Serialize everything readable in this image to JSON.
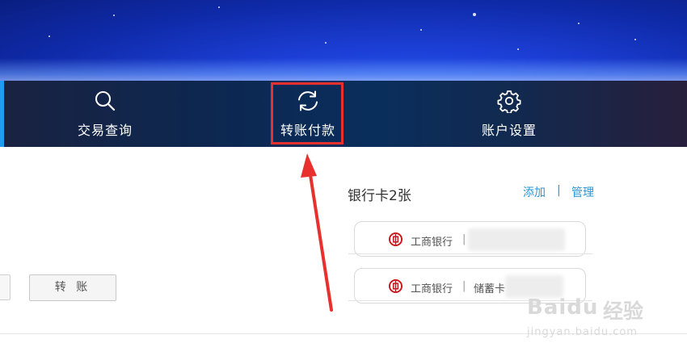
{
  "nav": {
    "items": [
      {
        "label": "交易查询",
        "icon": "search-icon"
      },
      {
        "label": "转账付款",
        "icon": "refresh-icon"
      },
      {
        "label": "账户设置",
        "icon": "gear-icon"
      }
    ],
    "accent_color": "#1e9cf0",
    "highlight_color": "#e8312f"
  },
  "main": {
    "transfer_button_label": "转 账"
  },
  "cards": {
    "title": "银行卡2张",
    "add_label": "添加",
    "separator": "|",
    "manage_label": "管理",
    "items": [
      {
        "bank": "工商银行",
        "sep": "|",
        "type": "",
        "icon": "icbc-logo-icon"
      },
      {
        "bank": "工商银行",
        "sep": "|",
        "type": "储蓄卡",
        "icon": "icbc-logo-icon"
      }
    ]
  },
  "watermark": {
    "brand": "Baidu",
    "suffix": "经验",
    "url": "jingyan.baidu.com"
  }
}
